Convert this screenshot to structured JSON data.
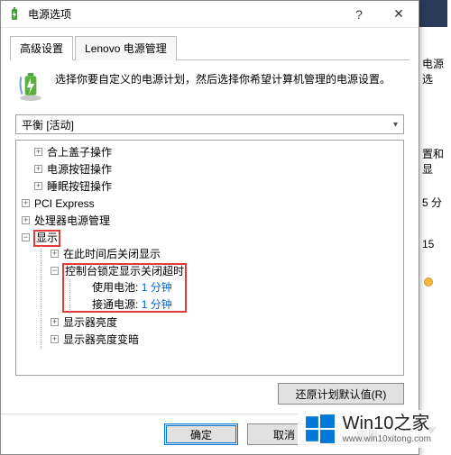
{
  "window": {
    "title": "电源选项",
    "help_symbol": "?",
    "close_symbol": "✕"
  },
  "tabs": {
    "advanced": "高级设置",
    "lenovo": "Lenovo 电源管理"
  },
  "intro_text": "选择你要自定义的电源计划，然后选择你希望计算机管理的电源设置。",
  "plan_dropdown": {
    "selected": "平衡 [活动]"
  },
  "tree": {
    "lid_action": "合上盖子操作",
    "power_button": "电源按钮操作",
    "sleep_button": "睡眠按钮操作",
    "pci_express": "PCI Express",
    "cpu_power": "处理器电源管理",
    "display": "显示",
    "display_off_after": "在此时间后关闭显示",
    "console_lock_timeout": "控制台锁定显示关闭超时",
    "on_battery_label": "使用电池:",
    "on_battery_value": "1 分钟",
    "plugged_in_label": "接通电源:",
    "plugged_in_value": "1 分钟",
    "display_brightness": "显示器亮度",
    "display_dim": "显示器亮度变暗"
  },
  "buttons": {
    "restore_defaults": "还原计划默认值(R)",
    "ok": "确定",
    "cancel": "取消",
    "apply": "应用"
  },
  "background": {
    "section1": "电源选",
    "section2": "置和显",
    "val1": "5 分",
    "val2": "15"
  },
  "watermark": {
    "title": "Win10之家",
    "url": "www.win10xitong.com"
  }
}
